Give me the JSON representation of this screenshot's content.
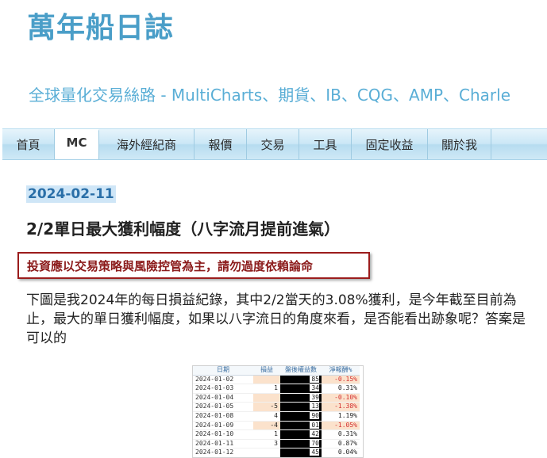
{
  "blog": {
    "title": "萬年船日誌",
    "description": "全球量化交易絲路 - MultiCharts、期貨、IB、CQG、AMP、Charle"
  },
  "nav": {
    "items": [
      {
        "label": "首頁"
      },
      {
        "label": "MC"
      },
      {
        "label": "海外經紀商"
      },
      {
        "label": "報價"
      },
      {
        "label": "交易"
      },
      {
        "label": "工具"
      },
      {
        "label": "固定收益"
      },
      {
        "label": "關於我"
      }
    ],
    "active": "MC"
  },
  "post": {
    "date": "2024-02-11",
    "title": "2/2單日最大獲利幅度（八字流月提前進氣）",
    "warning": "投資應以交易策略與風險控管為主，請勿過度依賴論命",
    "body": "下圖是我2024年的每日損益紀錄，其中2/2當天的3.08%獲利，是今年截至目前為止，最大的單日獲利幅度，如果以八字流日的角度來看，是否能看出跡象呢？答案是可以的"
  },
  "table": {
    "headers": [
      "日期",
      "損益",
      "盤後權益數",
      "淨報酬%"
    ],
    "rows": [
      {
        "date": "2024-01-02",
        "pnl": "",
        "cap": "85",
        "pct": "-0.15%",
        "neg": true
      },
      {
        "date": "2024-01-03",
        "pnl": "1",
        "cap": "34",
        "pct": "0.31%",
        "neg": false
      },
      {
        "date": "2024-01-04",
        "pnl": "",
        "cap": "39",
        "pct": "-0.10%",
        "neg": true
      },
      {
        "date": "2024-01-05",
        "pnl": "-5",
        "cap": "13",
        "pct": "-1.38%",
        "neg": true
      },
      {
        "date": "2024-01-08",
        "pnl": "4",
        "cap": "90",
        "pct": "1.19%",
        "neg": false
      },
      {
        "date": "2024-01-09",
        "pnl": "-4",
        "cap": "01",
        "pct": "-1.05%",
        "neg": true
      },
      {
        "date": "2024-01-10",
        "pnl": "1",
        "cap": "42",
        "pct": "0.31%",
        "neg": false
      },
      {
        "date": "2024-01-11",
        "pnl": "3",
        "cap": "70",
        "pct": "0.87%",
        "neg": false
      },
      {
        "date": "2024-01-12",
        "pnl": "",
        "cap": "45",
        "pct": "0.04%",
        "neg": false
      }
    ]
  },
  "colors": {
    "title": "#4a9ec8",
    "date_highlight": "#cfe6f7",
    "warning_border": "#9b1c1c",
    "negative": "#d32f2f"
  }
}
